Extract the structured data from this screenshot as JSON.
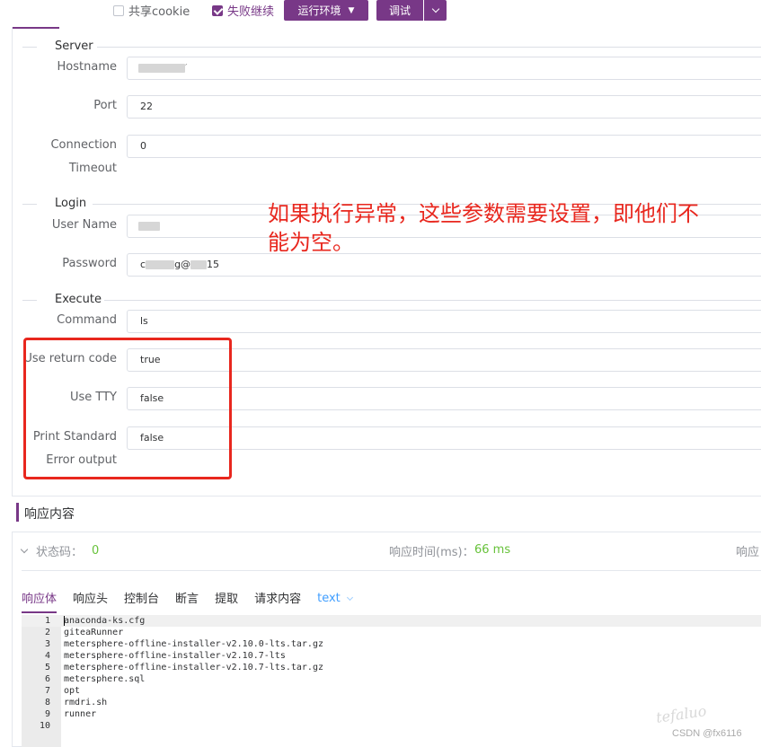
{
  "toolbar": {
    "share_cookie_label": "共享cookie",
    "share_cookie_checked": false,
    "fail_continue_label": "失败继续",
    "fail_continue_checked": true,
    "run_env_label": "运行环境",
    "debug_label": "调试"
  },
  "colors": {
    "accent": "#783887",
    "annotation": "#e8271e",
    "success": "#67c23a",
    "link": "#409eff"
  },
  "form": {
    "server_section": "Server",
    "hostname_label": "Hostname",
    "hostname_value": "",
    "port_label": "Port",
    "port_value": "22",
    "connection_label_1": "Connection",
    "connection_label_2": "Timeout",
    "connection_value": "0",
    "login_section": "Login",
    "username_label": "User Name",
    "username_value": "",
    "password_label": "Password",
    "password_value_prefix": "c",
    "password_value_mid": "g@",
    "password_value_suffix": "15",
    "execute_section": "Execute",
    "command_label": "Command",
    "command_value": "ls",
    "use_return_code_label": "Use return code",
    "use_return_code_value": "true",
    "use_tty_label": "Use TTY",
    "use_tty_value": "false",
    "print_std_label_1": "Print Standard",
    "print_std_label_2": "Error output",
    "print_std_value": "false"
  },
  "annotation": {
    "line1": "如果执行异常，这些参数需要设置，即他们不",
    "line2": "能为空。"
  },
  "response": {
    "title": "响应内容",
    "status_label": "状态码：",
    "status_value": "0",
    "time_label": "响应时间(ms)：",
    "time_value": "66 ms",
    "size_label": "响应",
    "tabs": [
      "响应体",
      "响应头",
      "控制台",
      "断言",
      "提取",
      "请求内容"
    ],
    "format_select": "text"
  },
  "editor": {
    "lines": [
      {
        "n": "1",
        "text": "anaconda-ks.cfg"
      },
      {
        "n": "2",
        "text": "giteaRunner"
      },
      {
        "n": "3",
        "text": "metersphere-offline-installer-v2.10.0-lts.tar.gz"
      },
      {
        "n": "4",
        "text": "metersphere-offline-installer-v2.10.7-lts"
      },
      {
        "n": "5",
        "text": "metersphere-offline-installer-v2.10.7-lts.tar.gz"
      },
      {
        "n": "6",
        "text": "metersphere.sql"
      },
      {
        "n": "7",
        "text": "opt"
      },
      {
        "n": "8",
        "text": "rmdri.sh"
      },
      {
        "n": "9",
        "text": "runner"
      },
      {
        "n": "10",
        "text": ""
      }
    ]
  },
  "watermark": {
    "text": "CSDN @fx6116",
    "signature": "tefaluo"
  }
}
